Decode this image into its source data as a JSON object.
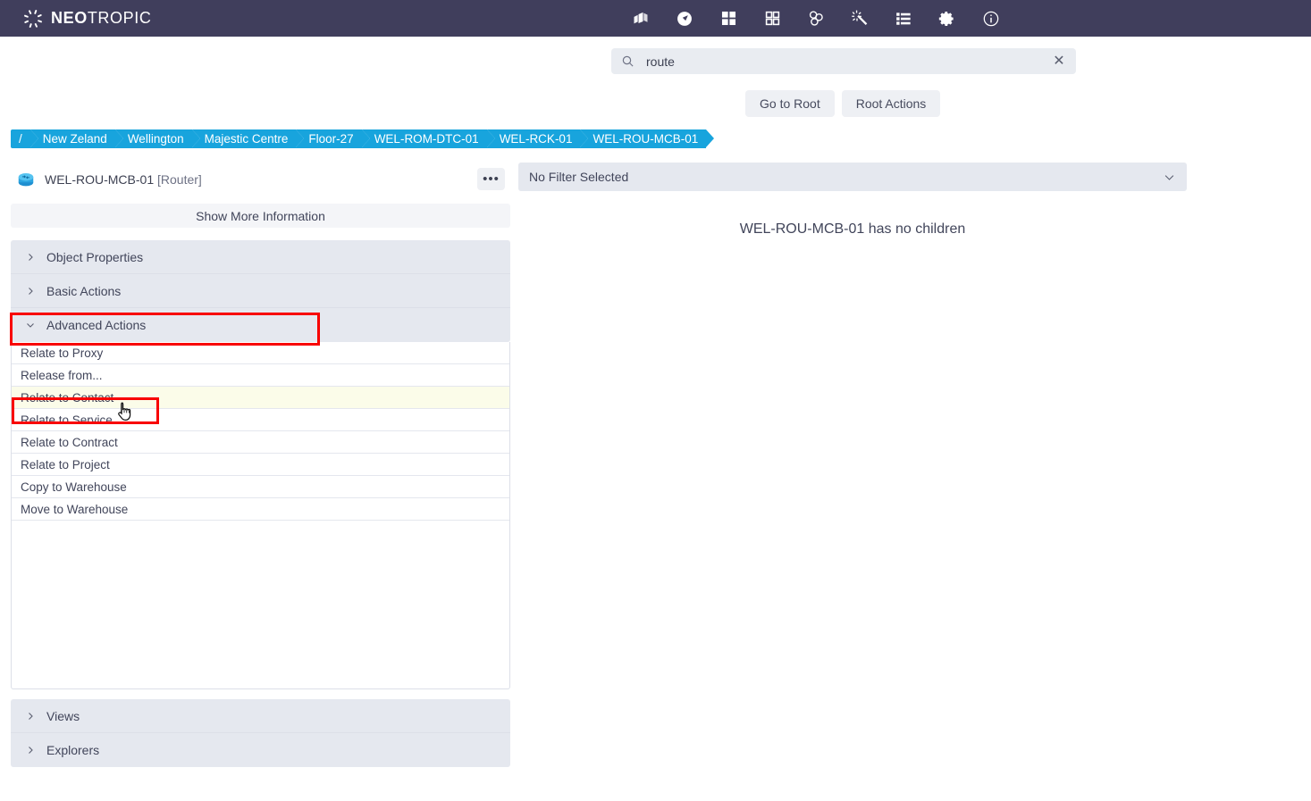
{
  "app": {
    "brand_bold": "NEO",
    "brand_light": "TROPIC",
    "brand_icon": "spinner-logo-icon",
    "header_bg": "#403e5c",
    "accent": "#18a4dd",
    "highlight": "#f80000"
  },
  "nav_icons": [
    {
      "name": "layers-3d-icon",
      "title": "3D View"
    },
    {
      "name": "compass-navigate-icon",
      "title": "Navigate"
    },
    {
      "name": "grid-large-icon",
      "title": "Dashboard"
    },
    {
      "name": "grid-small-icon",
      "title": "Tiles"
    },
    {
      "name": "molecule-icon",
      "title": "Topology"
    },
    {
      "name": "magic-wand-icon",
      "title": "Wizard"
    },
    {
      "name": "list-view-icon",
      "title": "Lists"
    },
    {
      "name": "gear-icon",
      "title": "Settings"
    },
    {
      "name": "info-icon",
      "title": "Info"
    }
  ],
  "search": {
    "icon": "search-icon",
    "value": "route",
    "placeholder": "Search",
    "clear_icon": "close-icon",
    "clear_glyph": "✕"
  },
  "root_buttons": [
    {
      "label": "Go to Root",
      "name": "go-to-root-button"
    },
    {
      "label": "Root Actions",
      "name": "root-actions-button"
    }
  ],
  "breadcrumb": [
    "/",
    "New Zeland",
    "Wellington",
    "Majestic Centre",
    "Floor-27",
    "WEL-ROM-DTC-01",
    "WEL-RCK-01",
    "WEL-ROU-MCB-01"
  ],
  "object": {
    "icon": "router-icon",
    "name": "WEL-ROU-MCB-01",
    "type": "[Router]",
    "more_glyph": "•••",
    "show_more_label": "Show More Information"
  },
  "accordions_top": [
    {
      "label": "Object Properties",
      "expanded": false,
      "name": "accordion-object-properties"
    },
    {
      "label": "Basic Actions",
      "expanded": false,
      "name": "accordion-basic-actions"
    },
    {
      "label": "Advanced Actions",
      "expanded": true,
      "name": "accordion-advanced-actions"
    }
  ],
  "advanced_actions": [
    {
      "label": "Relate to Proxy",
      "highlighted": false
    },
    {
      "label": "Release from...",
      "highlighted": false
    },
    {
      "label": "Relate to Contact",
      "highlighted": true
    },
    {
      "label": "Relate to Service",
      "highlighted": false
    },
    {
      "label": "Relate to Contract",
      "highlighted": false
    },
    {
      "label": "Relate to Project",
      "highlighted": false
    },
    {
      "label": "Copy to Warehouse",
      "highlighted": false
    },
    {
      "label": "Move to Warehouse",
      "highlighted": false
    }
  ],
  "accordions_bottom": [
    {
      "label": "Views",
      "expanded": false,
      "name": "accordion-views"
    },
    {
      "label": "Explorers",
      "expanded": false,
      "name": "accordion-explorers"
    }
  ],
  "right": {
    "filter_label": "No Filter Selected",
    "filter_chevron": "chevron-down-icon",
    "empty_message": "WEL-ROU-MCB-01 has no children"
  },
  "cursor": {
    "name": "pointing-hand-cursor"
  }
}
